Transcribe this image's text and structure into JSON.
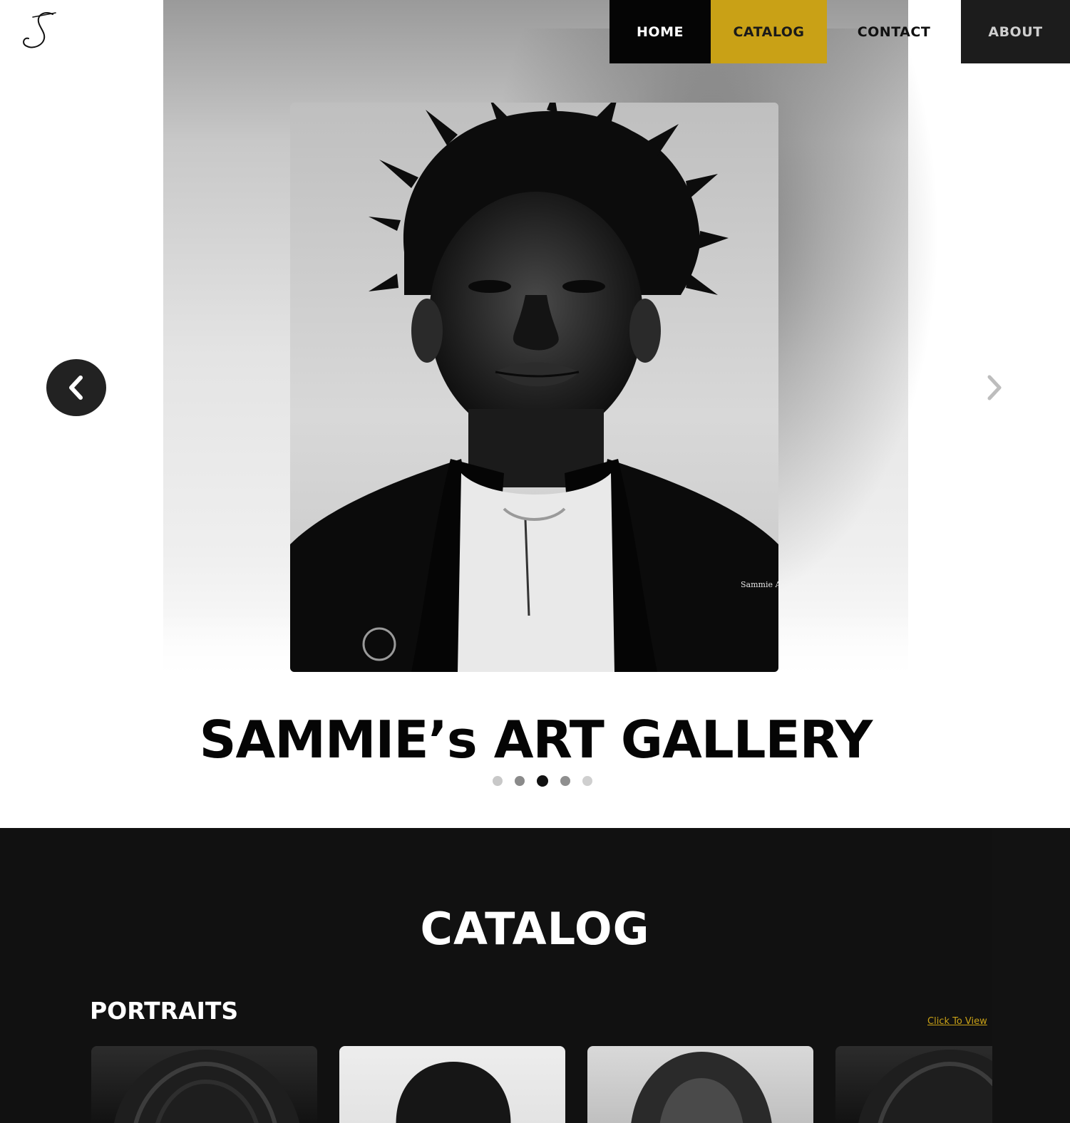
{
  "nav": {
    "logo": "S",
    "items": [
      {
        "label": "HOME"
      },
      {
        "label": "CATALOG"
      },
      {
        "label": "CONTACT"
      },
      {
        "label": "ABOUT"
      }
    ]
  },
  "hero": {
    "title": "SAMMIE’s  ART GALLERY",
    "portrait_signature": "Sammie Art",
    "slides": {
      "count": 5,
      "active_index": 2
    }
  },
  "catalog": {
    "title": "CATALOG",
    "section": "PORTRAITS",
    "link": "Click To View"
  },
  "icons": {
    "prev": "chevron-left-icon",
    "next": "chevron-right-icon"
  },
  "colors": {
    "accent": "#c9a116",
    "dark": "#111111",
    "nav_active": "#050505",
    "nav_about": "#1c1c1c"
  }
}
